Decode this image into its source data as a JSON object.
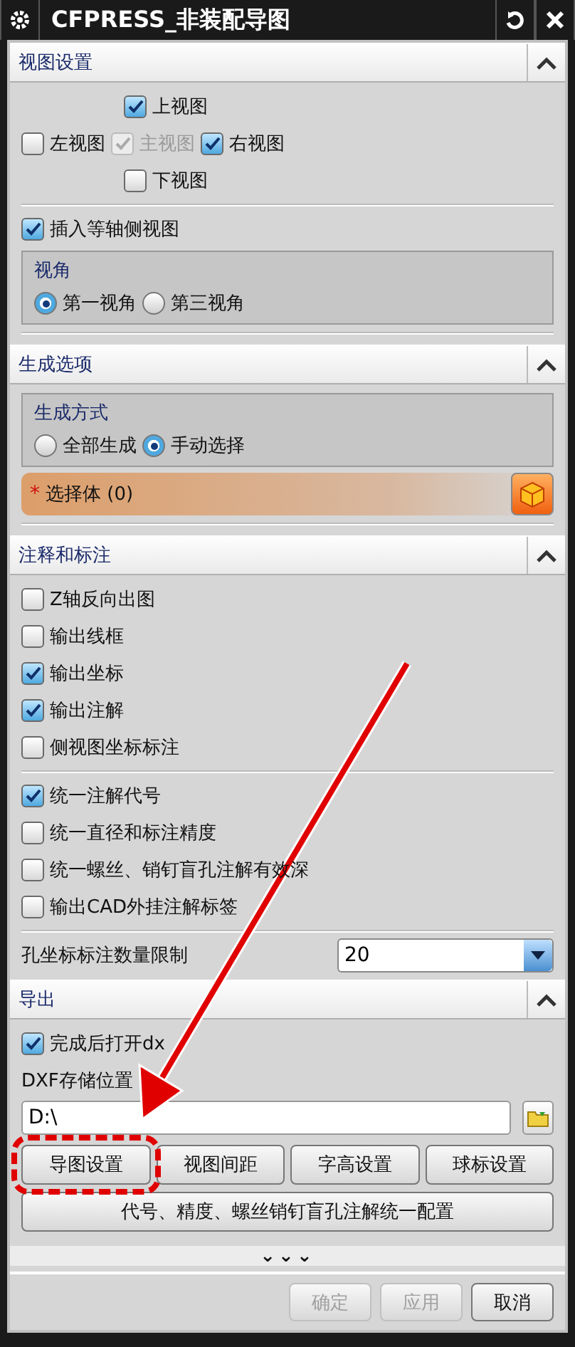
{
  "window": {
    "title": "CFPRESS_非装配导图"
  },
  "view_settings": {
    "title": "视图设置",
    "expanded": true,
    "views": [
      {
        "label": "上视图",
        "checked": true,
        "disabled": false
      },
      {
        "label": "左视图",
        "checked": false,
        "disabled": false
      },
      {
        "label": "主视图",
        "checked": true,
        "disabled": true
      },
      {
        "label": "右视图",
        "checked": true,
        "disabled": false
      },
      {
        "label": "下视图",
        "checked": false,
        "disabled": false
      }
    ],
    "isometric": {
      "label": "插入等轴侧视图",
      "checked": true
    },
    "angle": {
      "title": "视角",
      "options": [
        {
          "label": "第一视角",
          "selected": true
        },
        {
          "label": "第三视角",
          "selected": false
        }
      ]
    }
  },
  "generate": {
    "title": "生成选项",
    "expanded": true,
    "mode": {
      "title": "生成方式",
      "options": [
        {
          "label": "全部生成",
          "selected": false
        },
        {
          "label": "手动选择",
          "selected": true
        }
      ]
    },
    "select": {
      "required_mark": "*",
      "label": "选择体 (0)"
    }
  },
  "annotation": {
    "title": "注释和标注",
    "expanded": true,
    "groups": [
      [
        {
          "label": "Z轴反向出图",
          "checked": false
        },
        {
          "label": "输出线框",
          "checked": false
        },
        {
          "label": "输出坐标",
          "checked": true
        },
        {
          "label": "输出注解",
          "checked": true
        },
        {
          "label": "侧视图坐标标注",
          "checked": false
        }
      ],
      [
        {
          "label": "统一注解代号",
          "checked": true
        },
        {
          "label": "统一直径和标注精度",
          "checked": false
        },
        {
          "label": "统一螺丝、销钉盲孔注解有效深",
          "checked": false
        },
        {
          "label": "输出CAD外挂注解标签",
          "checked": false
        }
      ]
    ],
    "limit": {
      "label": "孔坐标标注数量限制",
      "value": "20"
    }
  },
  "export": {
    "title": "导出",
    "expanded": true,
    "open_after": {
      "label": "完成后打开dx",
      "checked": true
    },
    "path": {
      "label": "DXF存储位置",
      "value": "D:\\"
    },
    "buttons": [
      "导图设置",
      "视图间距",
      "字高设置",
      "球标设置"
    ],
    "wide_button": "代号、精度、螺丝销钉盲孔注解统一配置"
  },
  "footer": {
    "more": "⌄⌄⌄",
    "buttons": [
      {
        "label": "确定",
        "disabled": true
      },
      {
        "label": "应用",
        "disabled": true
      },
      {
        "label": "取消",
        "disabled": false
      }
    ]
  }
}
